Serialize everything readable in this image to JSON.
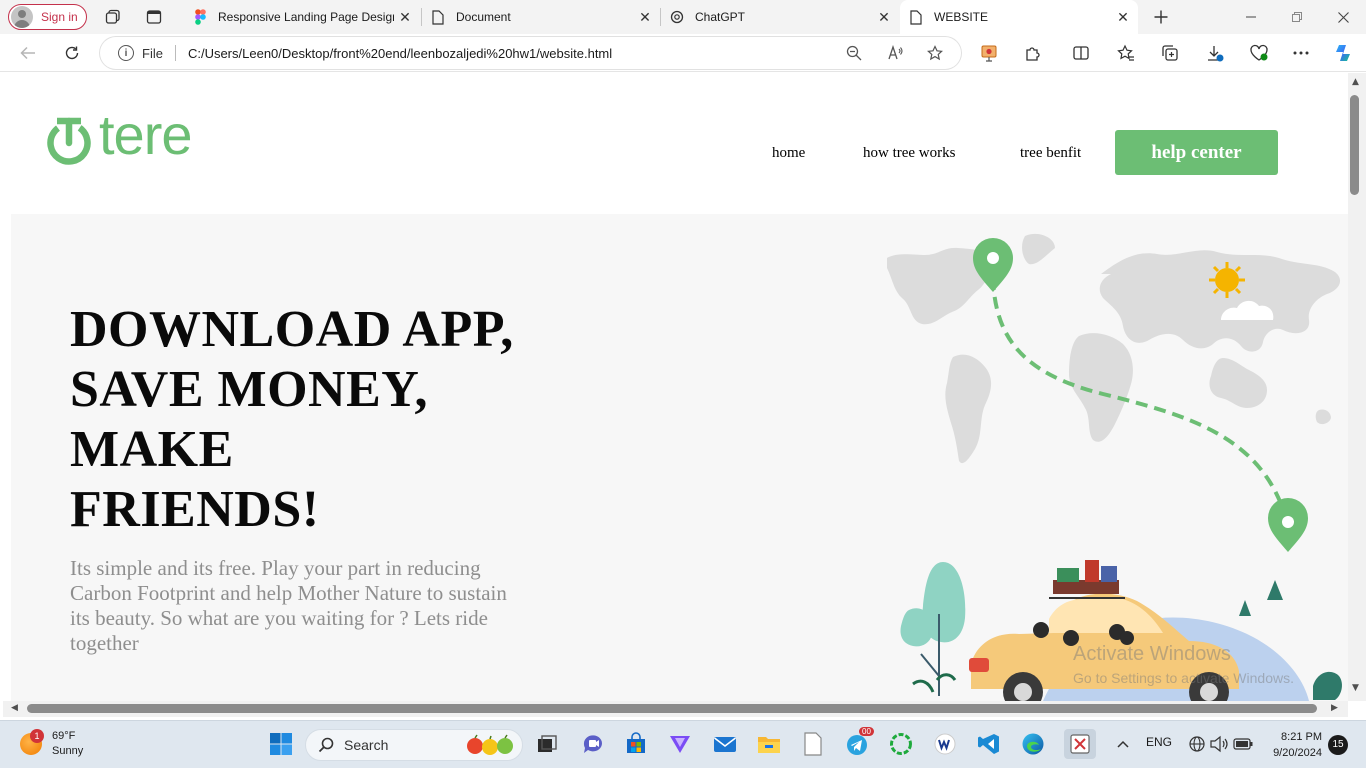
{
  "browser": {
    "signin_label": "Sign in",
    "tabs": [
      {
        "title": "Responsive Landing Page Design"
      },
      {
        "title": "Document"
      },
      {
        "title": "ChatGPT"
      },
      {
        "title": "WEBSITE"
      }
    ],
    "file_label": "File",
    "url": "C:/Users/Leen0/Desktop/front%20end/leenbozaljedi%20hw1/website.html"
  },
  "page": {
    "logo_text": "tere",
    "nav": [
      "home",
      "how tree works",
      "tree benfit"
    ],
    "help_button": "help center",
    "headline": [
      "DOWNLOAD APP,",
      "SAVE MONEY,",
      "MAKE",
      "FRIENDS!"
    ],
    "subtext": "Its simple and its free. Play your part in reducing Carbon Footprint and help Mother Nature to sustain its beauty. So what are you waiting for ? Lets ride together",
    "brand_color": "#6cbe74"
  },
  "watermark": {
    "line1": "Activate Windows",
    "line2": "Go to Settings to activate Windows."
  },
  "taskbar": {
    "weather_temp": "69°F",
    "weather_desc": "Sunny",
    "weather_badge": "1",
    "search_label": "Search",
    "telegram_badge": "00",
    "lang": "ENG",
    "time": "8:21 PM",
    "date": "9/20/2024",
    "notifications": "15"
  }
}
